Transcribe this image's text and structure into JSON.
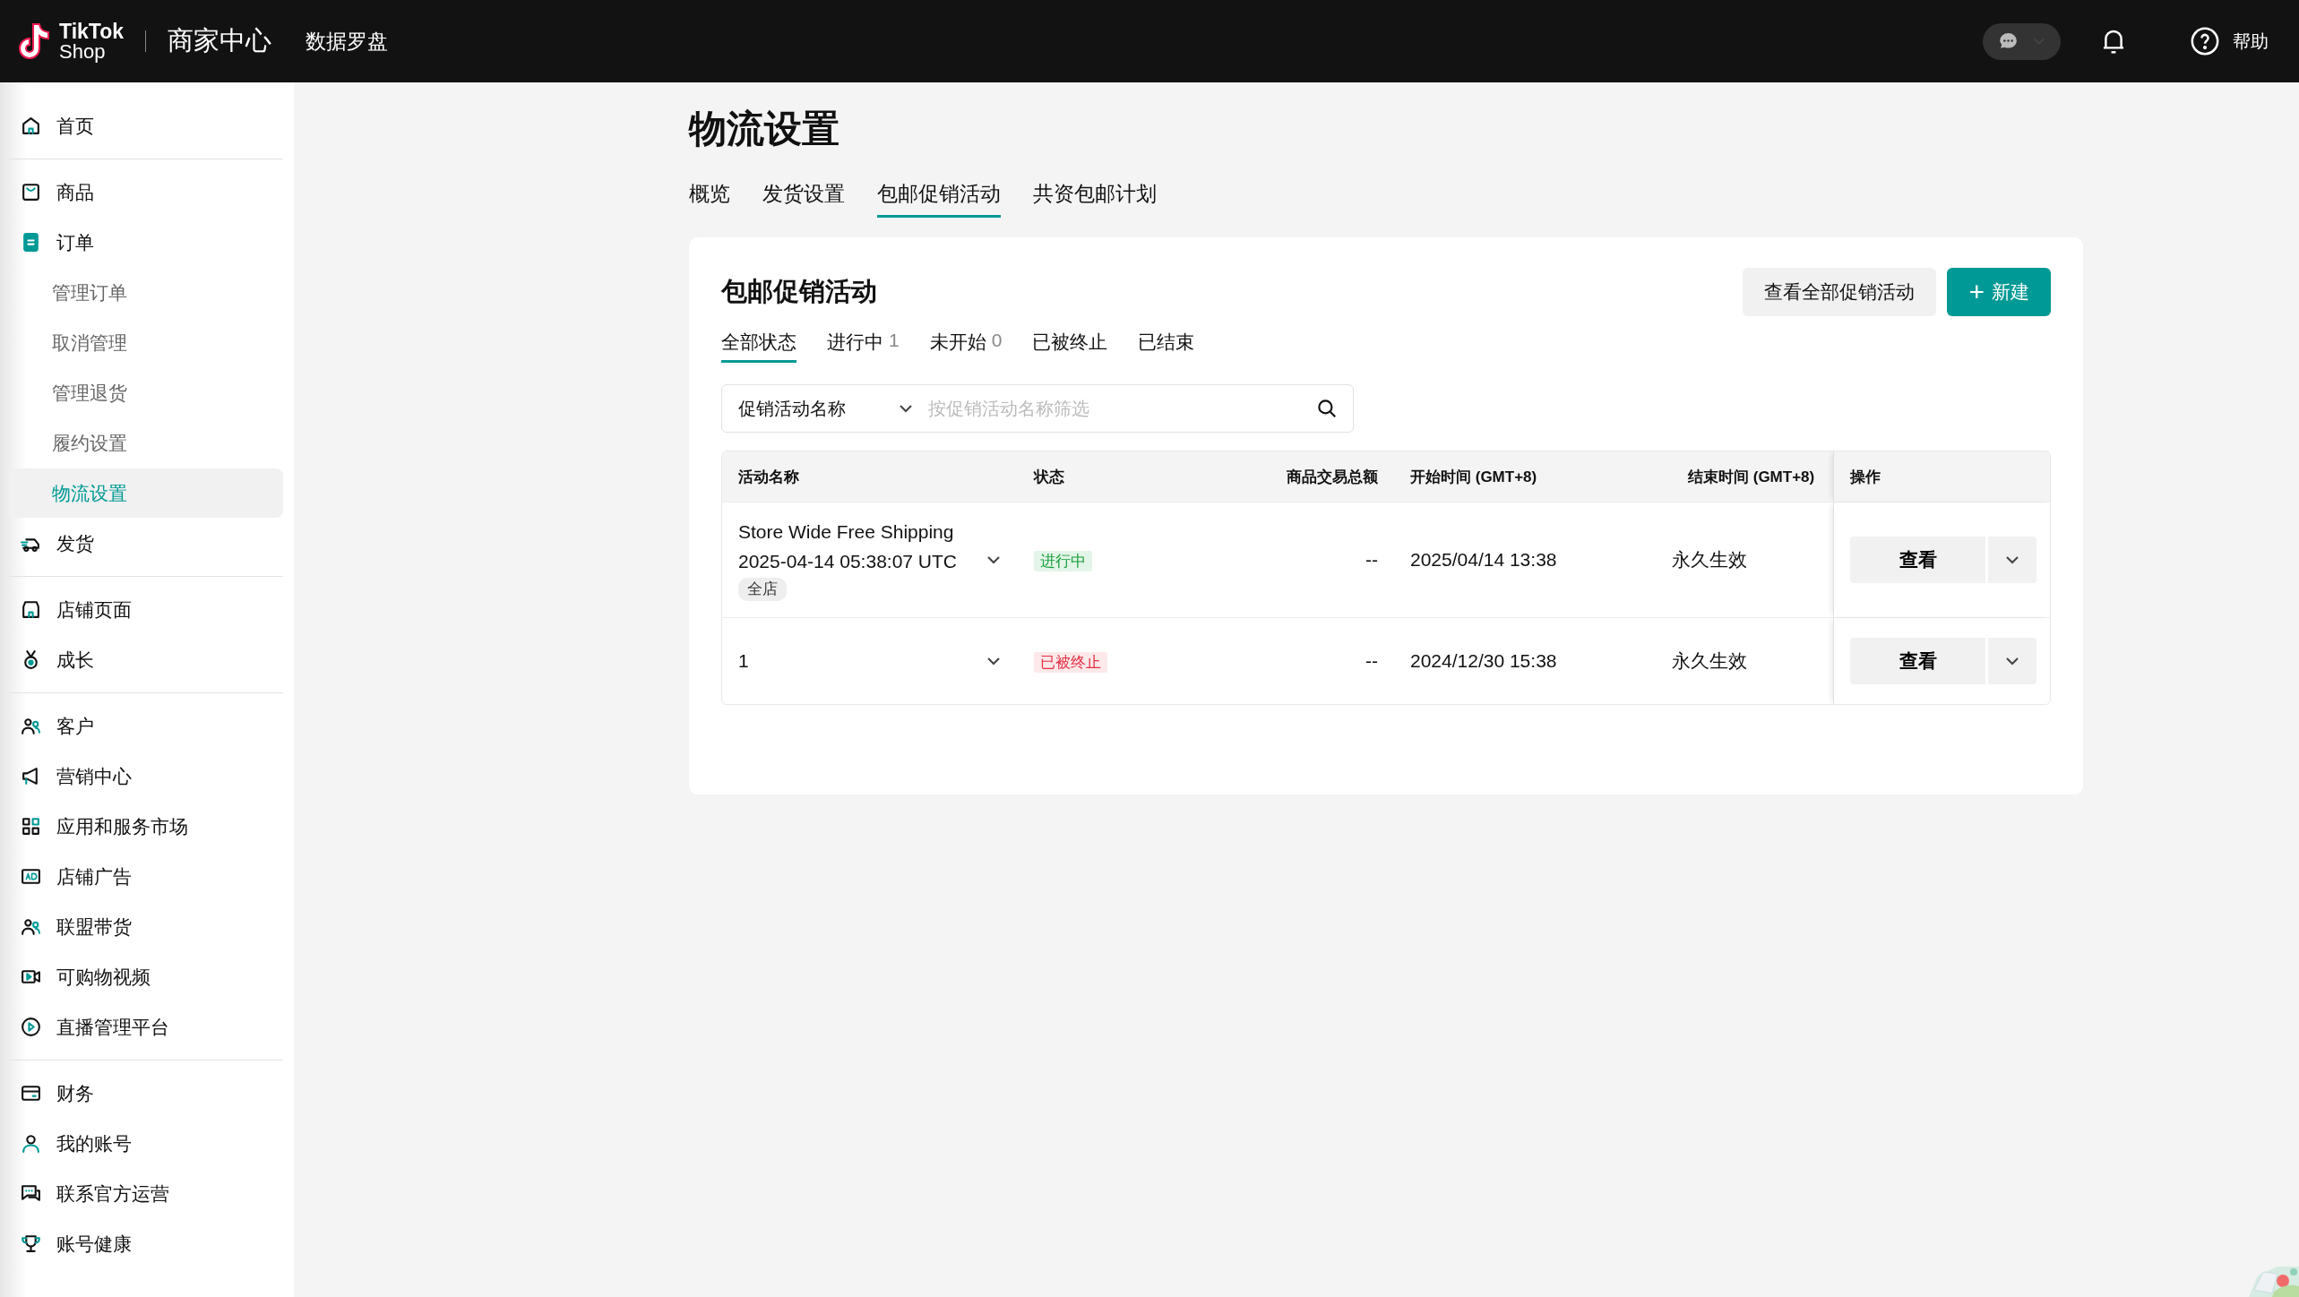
{
  "header": {
    "logo_top": "TikTok",
    "logo_bottom": "Shop",
    "title": "商家中心",
    "nav": "数据罗盘",
    "help": "帮助"
  },
  "sidebar": {
    "groups": [
      [
        {
          "label": "首页",
          "kind": "item",
          "selected": false
        }
      ],
      [
        {
          "label": "商品",
          "kind": "item",
          "selected": false
        },
        {
          "label": "订单",
          "kind": "item",
          "selected": false
        },
        {
          "label": "管理订单",
          "kind": "sub",
          "selected": false
        },
        {
          "label": "取消管理",
          "kind": "sub",
          "selected": false
        },
        {
          "label": "管理退货",
          "kind": "sub",
          "selected": false
        },
        {
          "label": "履约设置",
          "kind": "sub",
          "selected": false
        },
        {
          "label": "物流设置",
          "kind": "sub",
          "selected": true
        },
        {
          "label": "发货",
          "kind": "item",
          "selected": false
        }
      ],
      [
        {
          "label": "店铺页面",
          "kind": "item",
          "selected": false
        },
        {
          "label": "成长",
          "kind": "item",
          "selected": false
        }
      ],
      [
        {
          "label": "客户",
          "kind": "item",
          "selected": false
        },
        {
          "label": "营销中心",
          "kind": "item",
          "selected": false
        },
        {
          "label": "应用和服务市场",
          "kind": "item",
          "selected": false
        },
        {
          "label": "店铺广告",
          "kind": "item",
          "selected": false
        },
        {
          "label": "联盟带货",
          "kind": "item",
          "selected": false
        },
        {
          "label": "可购物视频",
          "kind": "item",
          "selected": false
        },
        {
          "label": "直播管理平台",
          "kind": "item",
          "selected": false
        }
      ],
      [
        {
          "label": "财务",
          "kind": "item",
          "selected": false
        },
        {
          "label": "我的账号",
          "kind": "item",
          "selected": false
        },
        {
          "label": "联系官方运营",
          "kind": "item",
          "selected": false
        },
        {
          "label": "账号健康",
          "kind": "item",
          "selected": false
        }
      ]
    ]
  },
  "page": {
    "title": "物流设置",
    "tabs": [
      {
        "label": "概览",
        "selected": false
      },
      {
        "label": "发货设置",
        "selected": false
      },
      {
        "label": "包邮促销活动",
        "selected": true
      },
      {
        "label": "共资包邮计划",
        "selected": false
      }
    ],
    "card": {
      "title": "包邮促销活动",
      "view_all_button": "查看全部促销活动",
      "new_button": "新建",
      "new_icon": "+",
      "status_tabs": [
        {
          "label": "全部状态",
          "selected": true
        },
        {
          "label": "进行中",
          "count": "1",
          "selected": false
        },
        {
          "label": "未开始",
          "count": "0",
          "selected": false
        },
        {
          "label": "已被终止",
          "selected": false
        },
        {
          "label": "已结束",
          "selected": false
        }
      ],
      "filter": {
        "select": "促销活动名称",
        "placeholder": "按促销活动名称筛选"
      },
      "table": {
        "columns": [
          "活动名称",
          "状态",
          "商品交易总额",
          "开始时间 (GMT+8)",
          "结束时间 (GMT+8)",
          "操作"
        ],
        "rows": [
          {
            "name": "Store Wide Free Shipping",
            "subtitle": "2025-04-14 05:38:07 UTC",
            "tag": "全店",
            "status": {
              "text": "进行中",
              "kind": "active"
            },
            "gmv": "--",
            "start": "2025/04/14 13:38",
            "end": "永久生效",
            "action": "查看"
          },
          {
            "name": "1",
            "status": {
              "text": "已被终止",
              "kind": "terminated"
            },
            "gmv": "--",
            "start": "2024/12/30 15:38",
            "end": "永久生效",
            "action": "查看"
          }
        ]
      }
    }
  }
}
